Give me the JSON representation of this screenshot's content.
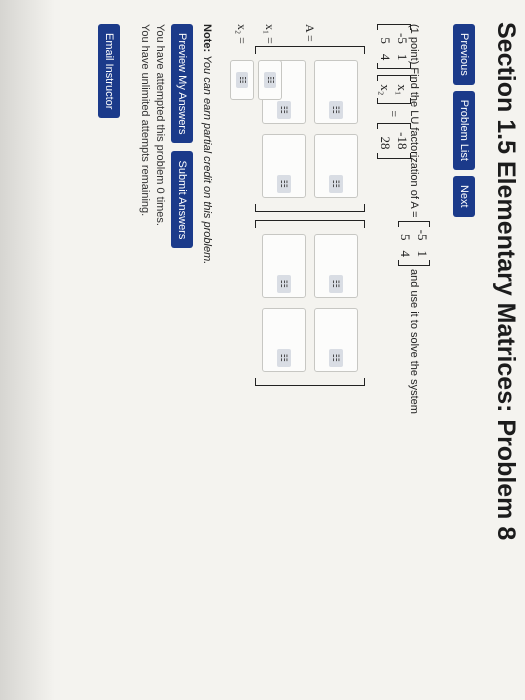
{
  "page_title": "Section 1.5 Elementary Matrices: Problem 8",
  "nav": {
    "previous": "Previous",
    "problem_list": "Problem List",
    "next": "Next"
  },
  "problem": {
    "points": "(1 point)",
    "prompt_prefix": "Find the LU factorization of A =",
    "prompt_suffix": "and use it to solve the system",
    "A_matrix": [
      "-5",
      "1",
      "5",
      "4"
    ],
    "x_vector": [
      "x₁",
      "x₂"
    ],
    "b_vector": [
      "-18",
      "28"
    ],
    "eq_sign": "=",
    "A_label": "A =",
    "x1_label": "x₁ =",
    "x2_label": "x₂ =",
    "grip_glyph": "☷"
  },
  "note": {
    "label": "Note:",
    "text": "You can earn partial credit on this problem."
  },
  "actions": {
    "preview": "Preview My Answers",
    "submit": "Submit Answers"
  },
  "attempts": {
    "line1": "You have attempted this problem 0 times.",
    "line2": "You have unlimited attempts remaining."
  },
  "email_button": "Email Instructor",
  "colors": {
    "accent": "#1b3a8a",
    "background": "#f4f3ef"
  }
}
